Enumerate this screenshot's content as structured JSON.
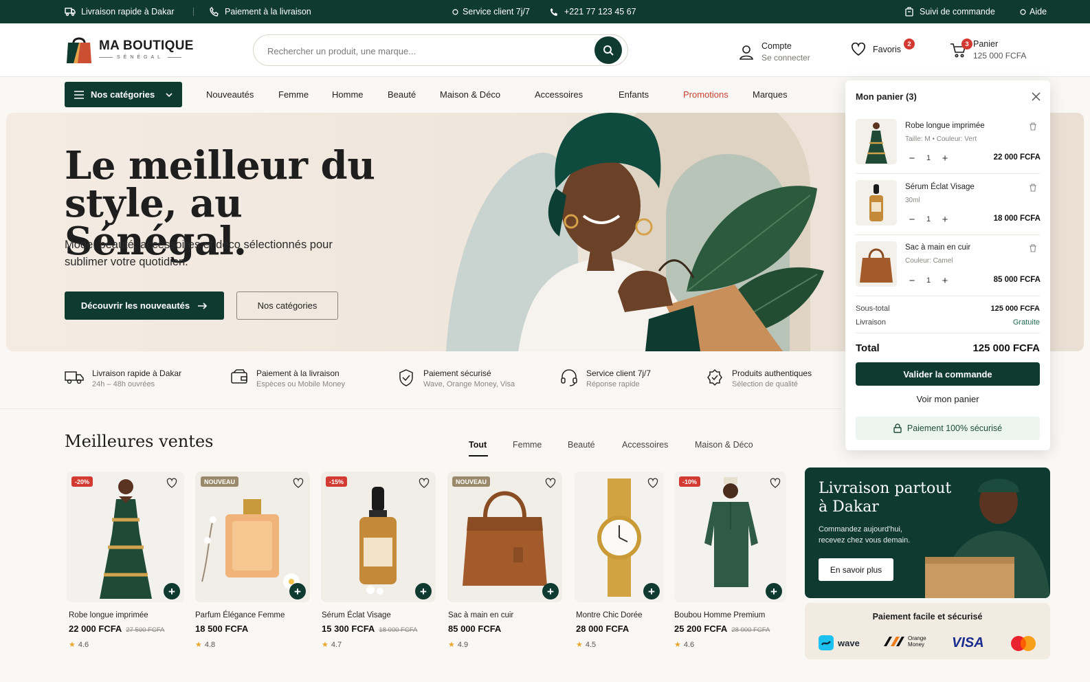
{
  "topbar": {
    "delivery": "Livraison rapide à Dakar",
    "payment": "Paiement à la livraison",
    "service": "Service client 7j/7",
    "phone": "+221 77 123 45 67",
    "tracking": "Suivi de commande",
    "help": "Aide"
  },
  "brand": {
    "name": "MA BOUTIQUE",
    "sub": "SÉNÉGAL"
  },
  "search": {
    "placeholder": "Rechercher un produit, une marque..."
  },
  "account": {
    "label": "Compte",
    "sub": "Se connecter"
  },
  "favorites": {
    "label": "Favoris",
    "count": "2"
  },
  "cart_header": {
    "label": "Panier",
    "amount": "125 000 FCFA",
    "count": "3"
  },
  "nav": {
    "categories": "Nos catégories",
    "links": [
      "Nouveautés",
      "Femme",
      "Homme",
      "Beauté",
      "Maison & Déco",
      "Accessoires",
      "Enfants",
      "Promotions",
      "Marques"
    ]
  },
  "hero": {
    "title": "Le meilleur du style, au Sénégal.",
    "subtitle": "Mode, beauté, accessoires et déco sélectionnés pour sublimer votre quotidien.",
    "cta_primary": "Découvrir les nouveautés",
    "cta_secondary": "Nos catégories"
  },
  "features": [
    {
      "title": "Livraison rapide à Dakar",
      "sub": "24h – 48h ouvrées",
      "icon": "truck-icon"
    },
    {
      "title": "Paiement à la livraison",
      "sub": "Espèces ou Mobile Money",
      "icon": "wallet-icon"
    },
    {
      "title": "Paiement sécurisé",
      "sub": "Wave, Orange Money, Visa",
      "icon": "shield-icon"
    },
    {
      "title": "Service client 7j/7",
      "sub": "Réponse rapide",
      "icon": "headset-icon"
    },
    {
      "title": "Produits authentiques",
      "sub": "Sélection de qualité",
      "icon": "badge-check-icon"
    }
  ],
  "bestsellers": {
    "title": "Meilleures ventes",
    "tabs": [
      "Tout",
      "Femme",
      "Beauté",
      "Accessoires",
      "Maison & Déco"
    ],
    "products": [
      {
        "name": "Robe longue imprimée",
        "price": "22 000 FCFA",
        "old": "27 500 FCFA",
        "rating": "4.6",
        "badge": "-20%"
      },
      {
        "name": "Parfum Élégance Femme",
        "price": "18 500 FCFA",
        "old": "",
        "rating": "4.8",
        "badge": "NOUVEAU"
      },
      {
        "name": "Sérum Éclat Visage",
        "price": "15 300 FCFA",
        "old": "18 000 FCFA",
        "rating": "4.7",
        "badge": "-15%"
      },
      {
        "name": "Sac à main en cuir",
        "price": "85 000 FCFA",
        "old": "",
        "rating": "4.9",
        "badge": "NOUVEAU"
      },
      {
        "name": "Montre Chic Dorée",
        "price": "28 000 FCFA",
        "old": "",
        "rating": "4.5",
        "badge": ""
      },
      {
        "name": "Boubou Homme Premium",
        "price": "25 200 FCFA",
        "old": "28 000 FCFA",
        "rating": "4.6",
        "badge": "-10%"
      }
    ]
  },
  "promo": {
    "title": "Livraison partout à Dakar",
    "subtitle": "Commandez aujourd'hui, recevez chez vous demain.",
    "button": "En savoir plus"
  },
  "payments": {
    "title": "Paiement facile et sécurisé",
    "wave": "wave",
    "orange_line1": "Orange",
    "orange_line2": "Money",
    "visa": "VISA"
  },
  "cart_panel": {
    "title": "Mon panier (3)",
    "items": [
      {
        "name": "Robe longue imprimée",
        "variant": "Taille: M  •  Couleur: Vert",
        "qty": "1",
        "price": "22 000 FCFA"
      },
      {
        "name": "Sérum Éclat Visage",
        "variant": "30ml",
        "qty": "1",
        "price": "18 000 FCFA"
      },
      {
        "name": "Sac à main en cuir",
        "variant": "Couleur: Camel",
        "qty": "1",
        "price": "85 000 FCFA"
      }
    ],
    "subtotal_label": "Sous-total",
    "subtotal": "125 000 FCFA",
    "delivery_label": "Livraison",
    "delivery": "Gratuite",
    "total_label": "Total",
    "total": "125 000 FCFA",
    "validate": "Valider la commande",
    "view": "Voir mon panier",
    "secure": "Paiement 100% sécurisé"
  },
  "colors": {
    "primary": "#0f3a30",
    "accent_red": "#d33b32",
    "promo_link": "#c8412f",
    "hero_bg": "#f1e9e0"
  }
}
